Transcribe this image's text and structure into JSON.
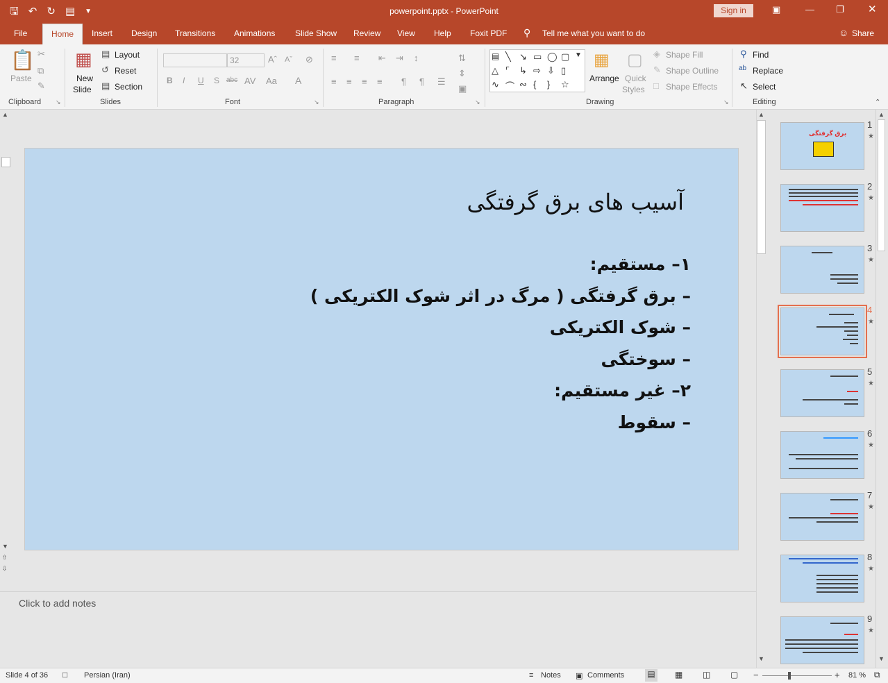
{
  "window": {
    "title": "powerpoint.pptx - PowerPoint",
    "sign_in": "Sign in",
    "share": "Share",
    "qat_icons": [
      "save-icon",
      "undo-icon",
      "redo-icon",
      "present-icon",
      "customize-icon"
    ]
  },
  "tabs": [
    "File",
    "Home",
    "Insert",
    "Design",
    "Transitions",
    "Animations",
    "Slide Show",
    "Review",
    "View",
    "Help",
    "Foxit PDF"
  ],
  "tell_me": "Tell me what you want to do",
  "ribbon": {
    "clipboard": {
      "paste": "Paste",
      "label": "Clipboard"
    },
    "slides": {
      "new_slide_1": "New",
      "new_slide_2": "Slide",
      "layout": "Layout",
      "reset": "Reset",
      "section": "Section",
      "label": "Slides"
    },
    "font": {
      "font_size": "32",
      "label": "Font",
      "bold": "B",
      "italic": "I",
      "underline": "U",
      "shadow": "S",
      "strike": "abc"
    },
    "paragraph": {
      "label": "Paragraph"
    },
    "drawing": {
      "arrange": "Arrange",
      "quick_styles_1": "Quick",
      "quick_styles_2": "Styles",
      "shape_fill": "Shape Fill",
      "shape_outline": "Shape Outline",
      "shape_effects": "Shape Effects",
      "label": "Drawing"
    },
    "editing": {
      "find": "Find",
      "replace": "Replace",
      "select": "Select",
      "label": "Editing"
    }
  },
  "slide": {
    "title": "آسیب های برق گرفتگی",
    "lines": [
      "۱– مستقیم:",
      "– برق گرفتگی ( مرگ در اثر شوک الکتریکی )",
      "– شوک الکتریکی",
      "– سوختگی",
      "۲– غیر مستقیم:",
      "– سقوط"
    ],
    "background": "#bdd7ee"
  },
  "notes_placeholder": "Click to add notes",
  "thumbnails": [
    "1",
    "2",
    "3",
    "4",
    "5",
    "6",
    "7",
    "8",
    "9"
  ],
  "selected_thumbnail": "4",
  "thumb1_text": "برق گرفتگی",
  "status": {
    "slide_info": "Slide 4 of 36",
    "language": "Persian (Iran)",
    "notes": "Notes",
    "comments": "Comments",
    "zoom": "81 %",
    "zoom_minus": "−",
    "zoom_plus": "+"
  },
  "colors": {
    "accent": "#b7472a",
    "selection": "#e4704f"
  }
}
